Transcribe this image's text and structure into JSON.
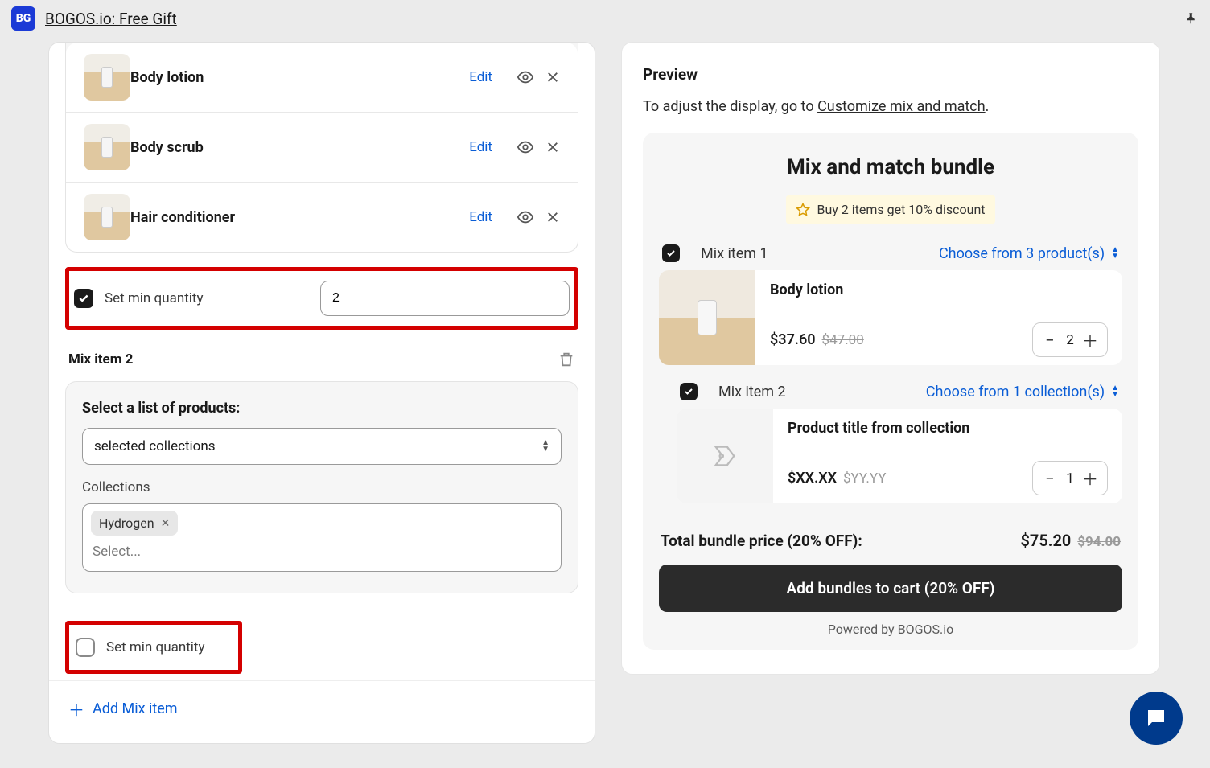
{
  "header": {
    "app_icon_text": "BG",
    "app_title": "BOGOS.io: Free Gift"
  },
  "left": {
    "products": [
      {
        "name": "Body lotion",
        "edit": "Edit"
      },
      {
        "name": "Body scrub",
        "edit": "Edit"
      },
      {
        "name": "Hair conditioner",
        "edit": "Edit"
      }
    ],
    "set_min_1_label": "Set min quantity",
    "set_min_1_value": "2",
    "mix2_title": "Mix item 2",
    "mix2_select_label": "Select a list of products:",
    "mix2_select_value": "selected collections",
    "mix2_collections_label": "Collections",
    "mix2_tag": "Hydrogen",
    "mix2_placeholder": "Select...",
    "set_min_2_label": "Set min quantity",
    "add_mix": "Add Mix item"
  },
  "right": {
    "preview_title": "Preview",
    "preview_sub_prefix": "To adjust the display, go to ",
    "preview_sub_link": "Customize mix and match",
    "bundle_heading": "Mix and match bundle",
    "promo": "Buy 2 items get 10% discount",
    "mix1_label": "Mix item 1",
    "mix1_link": "Choose from 3 product(s)",
    "p1_title": "Body lotion",
    "p1_price": "$37.60",
    "p1_old": "$47.00",
    "p1_qty": "2",
    "mix2_label": "Mix item 2",
    "mix2_link": "Choose from 1 collection(s)",
    "p2_title": "Product title from collection",
    "p2_price": "$XX.XX",
    "p2_old": "$YY.YY",
    "p2_qty": "1",
    "total_label": "Total bundle price (20% OFF):",
    "total_price": "$75.20",
    "total_old": "$94.00",
    "add_btn": "Add bundles to cart (20% OFF)",
    "powered": "Powered by BOGOS.io"
  }
}
